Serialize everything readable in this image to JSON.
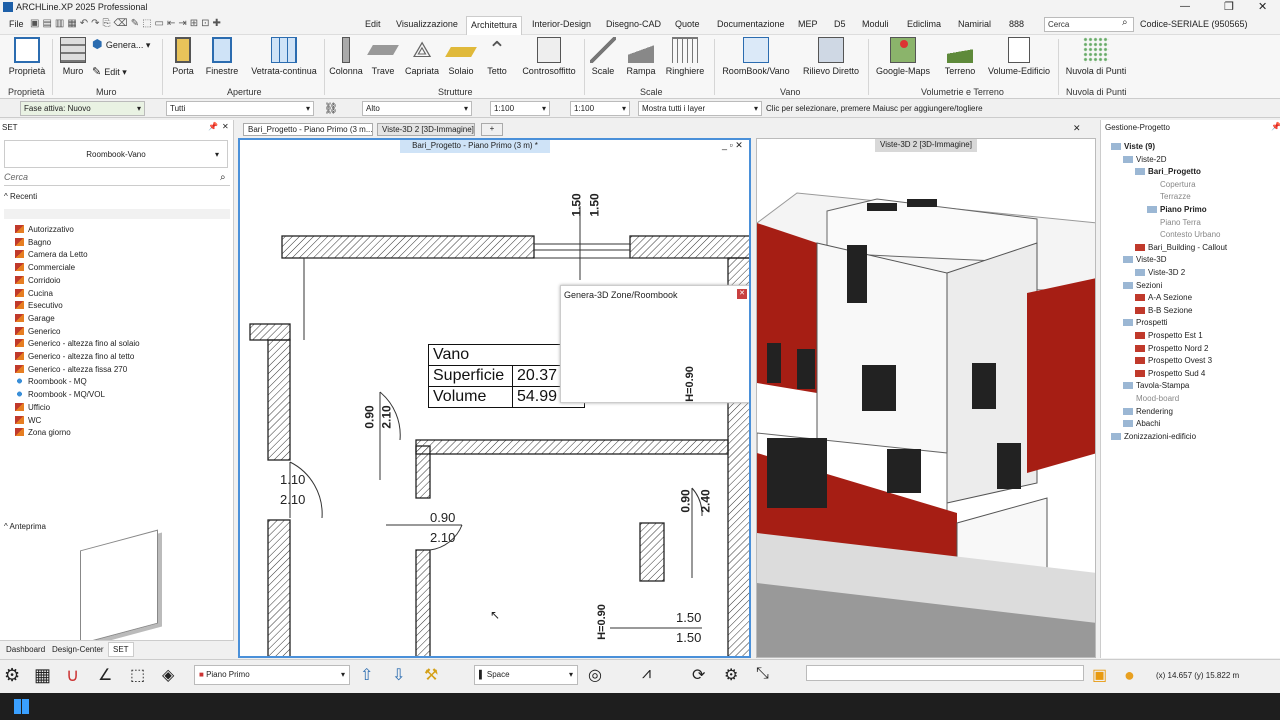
{
  "app": {
    "title": "ARCHLine.XP 2025 Professional"
  },
  "menu": [
    "File",
    "Edit",
    "Visualizzazione",
    "Architettura",
    "Interior-Design",
    "Disegno-CAD",
    "Quote",
    "Documentazione",
    "MEP",
    "D5",
    "Moduli",
    "Ediclima",
    "Namirial",
    "888"
  ],
  "search": {
    "placeholder": "Cerca"
  },
  "serial": "Codice-SERIALE (950565)",
  "ribbon": {
    "buttons": [
      "Proprietà",
      "Muro",
      "Genera...",
      "Edit",
      "Porta",
      "Finestre",
      "Vetrata-continua",
      "Colonna",
      "Trave",
      "Capriata",
      "Solaio",
      "Tetto",
      "Controsoffitto",
      "Scale",
      "Rampa",
      "Ringhiere",
      "RoomBook/Vano",
      "Rilievo Diretto",
      "Google-Maps",
      "Terreno",
      "Volume-Edificio",
      "Nuvola di Punti"
    ],
    "groups": [
      "Proprietà",
      "Muro",
      "Aperture",
      "Strutture",
      "Scale",
      "Vano",
      "Volumetrie e Terreno",
      "Nuvola di Punti"
    ]
  },
  "toolbar2": {
    "phase": "Fase attiva: Nuovo",
    "layer": "Tutti",
    "level": "Alto",
    "scale1": "1:100",
    "scale2": "1:100",
    "layers": "Mostra tutti i layer",
    "hint": "Clic per selezionare, premere Maiusc per aggiungere/togliere"
  },
  "left": {
    "title": "SET",
    "set": "Roombook-Vano",
    "search_placeholder": "Cerca",
    "recent": "Recenti",
    "preview": "Anteprima",
    "items": [
      "Autorizzativo",
      "Bagno",
      "Camera da Letto",
      "Commerciale",
      "Corridoio",
      "Cucina",
      "Esecutivo",
      "Garage",
      "Generico",
      "Generico - altezza fino al solaio",
      "Generico - altezza fino al tetto",
      "Generico - altezza fissa 270",
      "Roombook - MQ",
      "Roombook - MQ/VOL",
      "Ufficio",
      "WC",
      "Zona giorno"
    ],
    "tabs": [
      "Dashboard",
      "Design-Center",
      "SET"
    ]
  },
  "tabs": [
    "Bari_Progetto - Piano Primo (3 m...",
    "Viste-3D 2 [3D-Immagine]",
    "+"
  ],
  "plan": {
    "title": "Bari_Progetto - Piano Primo (3 m) *",
    "vano": {
      "name": "Vano",
      "surface_label": "Superficie",
      "surface": "20.37 m²",
      "volume_label": "Volume",
      "volume": "54.99 m³"
    },
    "dims": [
      "1.50",
      "1.50",
      "0.90",
      "2.10",
      "1.10",
      "2.10",
      "0.90",
      "2.10",
      "0.90",
      "2.40",
      "H=0.90",
      "H=0.90",
      "1.50",
      "1.50"
    ],
    "dialog": "Genera-3D Zone/Roombook"
  },
  "view3d": {
    "title": "Viste-3D 2 [3D-Immagine]"
  },
  "right": {
    "title": "Gestione-Progetto",
    "tree": [
      "Viste (9)",
      "Viste-2D",
      "Bari_Progetto",
      "Copertura",
      "Terrazze",
      "Piano Primo",
      "Piano Terra",
      "Contesto Urbano",
      "Bari_Building - Callout",
      "Viste-3D",
      "Viste-3D 2",
      "Sezioni",
      "A-A Sezione",
      "B-B Sezione",
      "Prospetti",
      "Prospetto Est 1",
      "Prospetto Nord 2",
      "Prospetto Ovest 3",
      "Prospetto Sud 4",
      "Tavola-Stampa",
      "Mood-board",
      "Rendering",
      "Abachi",
      "Zonizzazioni-edificio"
    ]
  },
  "status": {
    "floor": "Piano Primo",
    "style": "Space",
    "coords": "(x) 14.657  (y) 15.822 m"
  },
  "colors": {
    "accent": "#2b6cb0",
    "red": "#b52418",
    "wall": "#ffffff"
  }
}
